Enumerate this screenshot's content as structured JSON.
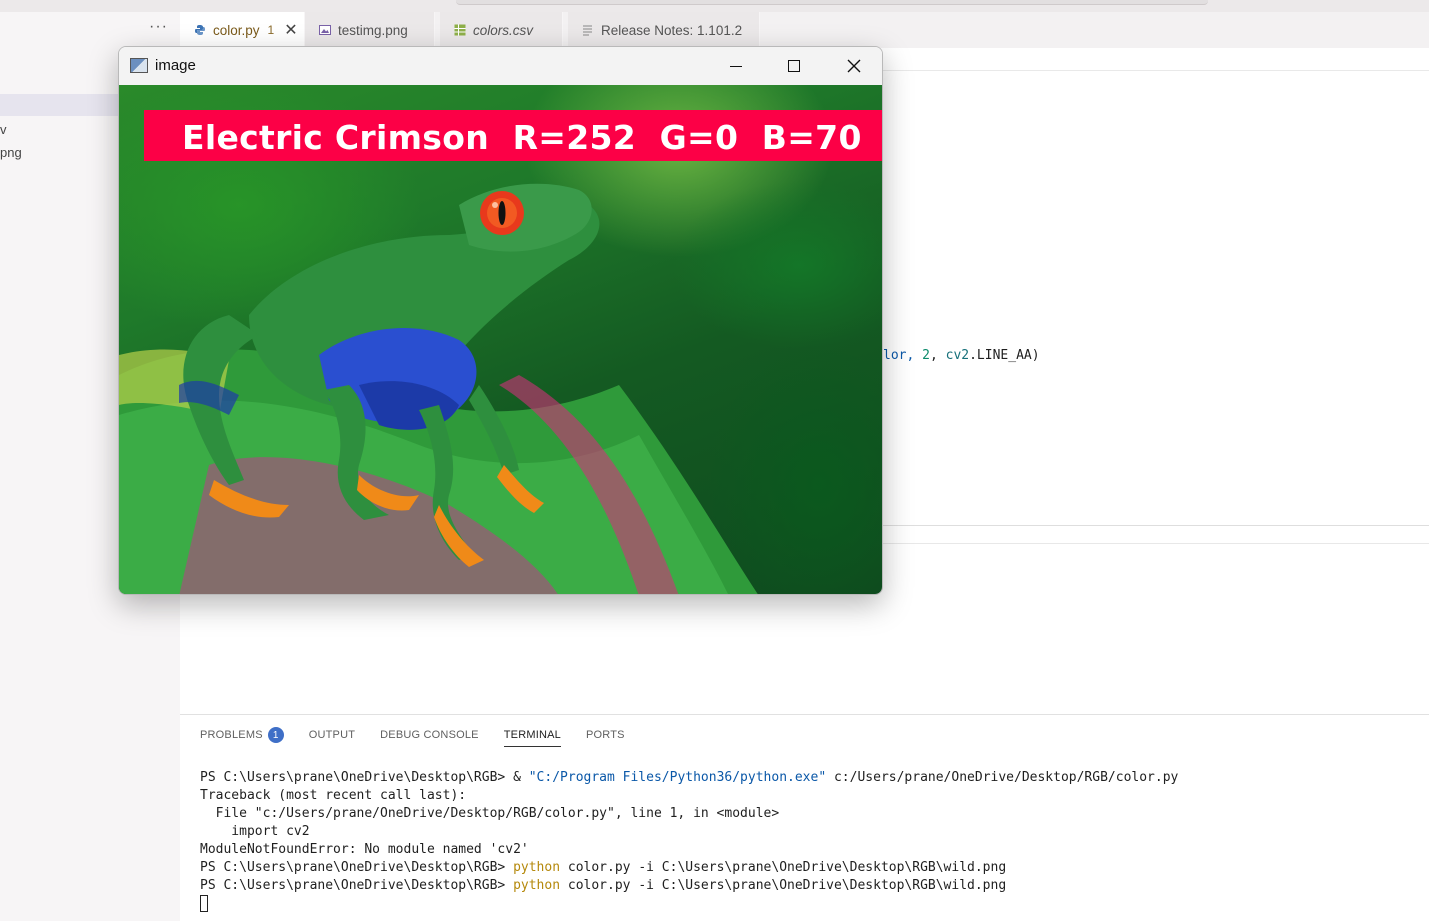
{
  "sidebar": {
    "items": [
      "v",
      "png"
    ]
  },
  "tabs": [
    {
      "label": "color.py",
      "badge": "1",
      "active": true,
      "icon": "python-icon"
    },
    {
      "label": "testimg.png",
      "active": false,
      "icon": "image-file-icon"
    },
    {
      "label": "colors.csv",
      "active": false,
      "icon": "csv-table-icon"
    },
    {
      "label": "Release Notes: 1.101.2",
      "active": false,
      "icon": "document-lines-icon"
    }
  ],
  "editor": {
    "code_fragment": {
      "a": "lor, ",
      "b": "2",
      "c": ", ",
      "d": "cv2",
      "e": ".LINE_AA)"
    }
  },
  "image_window": {
    "title": "image",
    "overlay_text": "Electric Crimson  R=252  G=0  B=70",
    "overlay_color": "#fc0046"
  },
  "panel": {
    "tabs": [
      {
        "label": "PROBLEMS",
        "badge": "1"
      },
      {
        "label": "OUTPUT"
      },
      {
        "label": "DEBUG CONSOLE"
      },
      {
        "label": "TERMINAL",
        "active": true
      },
      {
        "label": "PORTS"
      }
    ],
    "terminal": {
      "l1_prompt": "PS C:\\Users\\prane\\OneDrive\\Desktop\\RGB> & ",
      "l1_exe": "\"C:/Program Files/Python36/python.exe\"",
      "l1_rest": " c:/Users/prane/OneDrive/Desktop/RGB/color.py",
      "l2": "Traceback (most recent call last):",
      "l3": "  File \"c:/Users/prane/OneDrive/Desktop/RGB/color.py\", line 1, in <module>",
      "l4": "    import cv2",
      "l5": "ModuleNotFoundError: No module named 'cv2'",
      "l6_prompt": "PS C:\\Users\\prane\\OneDrive\\Desktop\\RGB> ",
      "l6_cmd": "python",
      "l6_rest": " color.py -i C:\\Users\\prane\\OneDrive\\Desktop\\RGB\\wild.png",
      "l7_prompt": "PS C:\\Users\\prane\\OneDrive\\Desktop\\RGB> ",
      "l7_cmd": "python",
      "l7_rest": " color.py -i C:\\Users\\prane\\OneDrive\\Desktop\\RGB\\wild.png"
    }
  }
}
